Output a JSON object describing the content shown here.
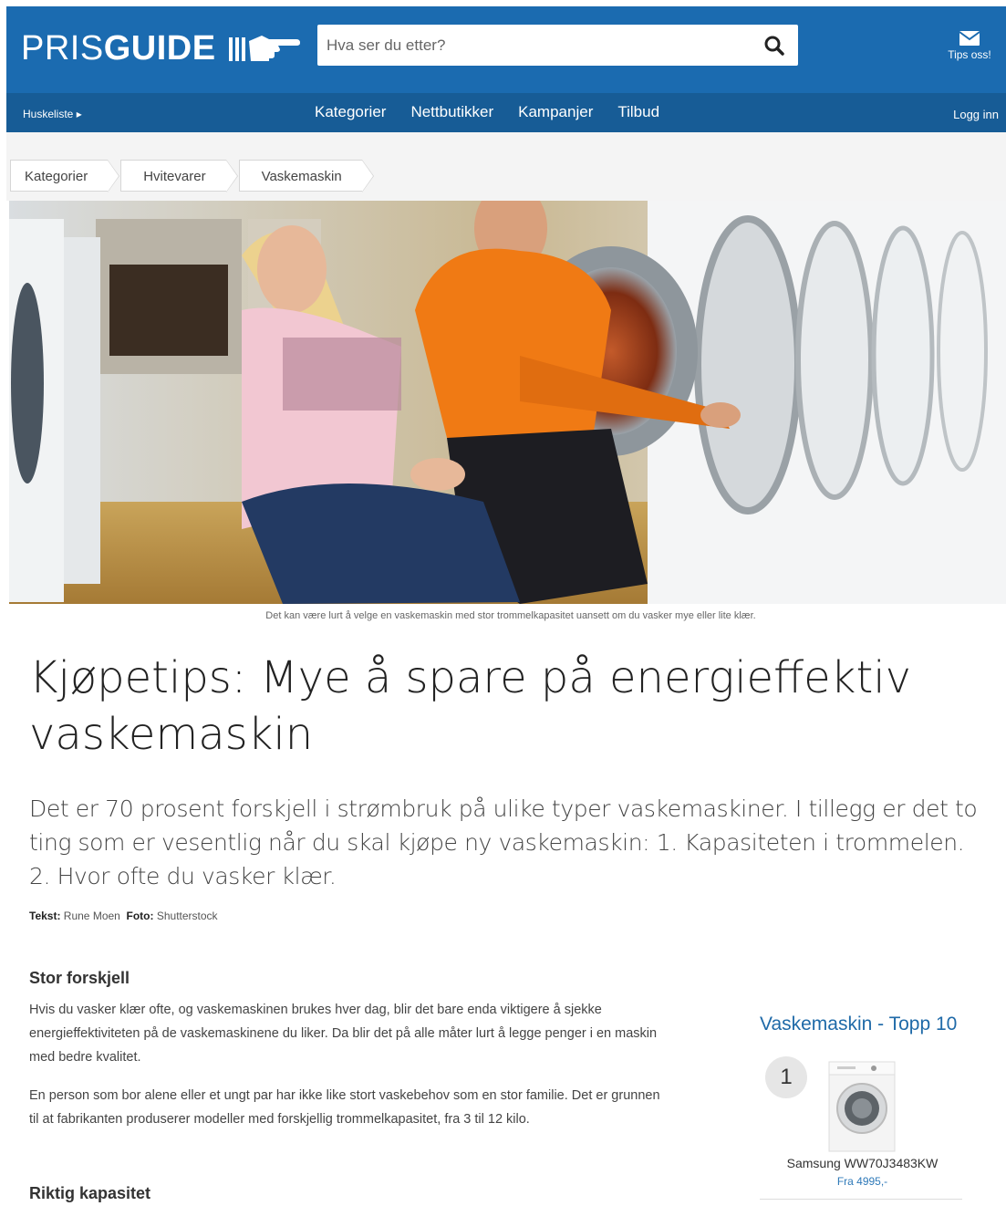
{
  "header": {
    "logo_light": "PRIS",
    "logo_bold": "GUIDE",
    "search_placeholder": "Hva ser du etter?",
    "tips_label": "Tips oss!"
  },
  "navbar": {
    "huskeliste": "Huskeliste ▸",
    "items": [
      "Kategorier",
      "Nettbutikker",
      "Kampanjer",
      "Tilbud"
    ],
    "login": "Logg inn"
  },
  "breadcrumb": [
    "Kategorier",
    "Hvitevarer",
    "Vaskemaskin"
  ],
  "hero": {
    "caption": "Det kan være lurt å velge en vaskemaskin med stor trommelkapasitet uansett om du vasker mye eller lite klær."
  },
  "article": {
    "title": "Kjøpetips: Mye å spare på energieffektiv vaskemaskin",
    "lead": "Det er 70 prosent forskjell i strømbruk på ulike typer vaskemaskiner. I tillegg er det to ting som er vesentlig når du skal kjøpe ny vaskemaskin: 1. Kapasiteten i trommelen. 2. Hvor ofte du vasker klær.",
    "byline_text_label": "Tekst:",
    "byline_text": "Rune Moen",
    "byline_photo_label": "Foto:",
    "byline_photo": "Shutterstock",
    "section1_heading": "Stor forskjell",
    "section1_p1": "Hvis du vasker klær ofte, og vaskemaskinen brukes hver dag, blir det bare enda viktigere å sjekke energieffektiviteten på de vaskemaskinene du liker. Da blir det på alle måter lurt å legge penger i en maskin med bedre kvalitet.",
    "section1_p2": "En person som bor alene eller et ungt par har ikke like stort vaskebehov som en stor familie. Det er grunnen til at fabrikanten produserer modeller med forskjellig trommelkapasitet, fra 3 til 12 kilo.",
    "section2_heading": "Riktig kapasitet"
  },
  "sidebar": {
    "top10_title": "Vaskemaskin - Topp 10",
    "item_rank": "1",
    "item_name": "Samsung WW70J3483KW",
    "item_price": "Fra 4995,-"
  },
  "colors": {
    "header_blue": "#1b6bb0",
    "nav_blue": "#175c96",
    "link_blue": "#1f6aa8"
  }
}
